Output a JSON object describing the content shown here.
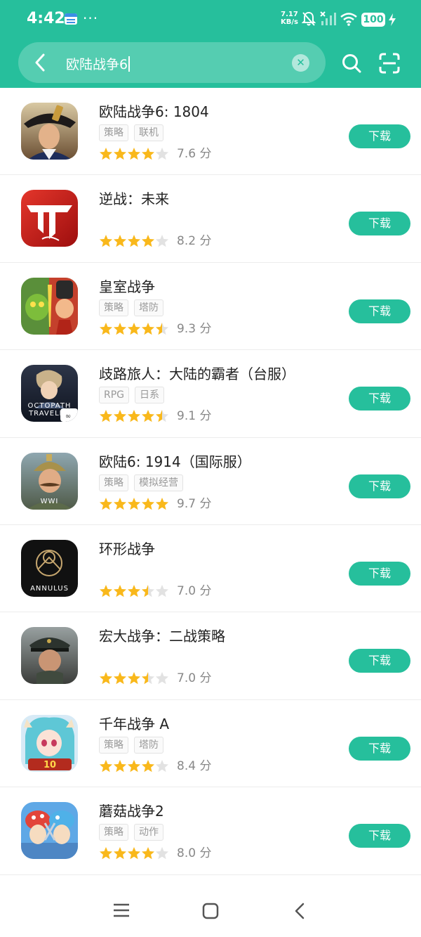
{
  "status_bar": {
    "time": "4:42",
    "more": "···",
    "speed_value": "7.17",
    "speed_unit": "KB/s",
    "battery": "100"
  },
  "search": {
    "query": "欧陆战争6"
  },
  "colors": {
    "accent": "#26bf9c",
    "star": "#f9b81b",
    "star_empty": "#e2e2e2"
  },
  "download_label": "下载",
  "apps": [
    {
      "name": "欧陆战争6: 1804",
      "tags": [
        "策略",
        "联机"
      ],
      "rating": 4,
      "score": "7.6 分",
      "icon": "napoleon-icon"
    },
    {
      "name": "逆战：未来",
      "tags": [],
      "rating": 4,
      "score": "8.2 分",
      "icon": "nizhan-logo-icon"
    },
    {
      "name": "皇室战争",
      "tags": [
        "策略",
        "塔防"
      ],
      "rating": 4.5,
      "score": "9.3 分",
      "icon": "clash-royale-icon"
    },
    {
      "name": "歧路旅人：大陆的霸者（台服）",
      "tags": [
        "RPG",
        "日系"
      ],
      "rating": 4.5,
      "score": "9.1 分",
      "icon": "octopath-icon",
      "icon_text": "OCTOPATH TRAVELER"
    },
    {
      "name": "欧陆6: 1914（国际服）",
      "tags": [
        "策略",
        "模拟经营"
      ],
      "rating": 5,
      "score": "9.7 分",
      "icon": "ww1-soldier-icon",
      "icon_text": "WWI"
    },
    {
      "name": "环形战争",
      "tags": [],
      "rating": 3.5,
      "score": "7.0 分",
      "icon": "annulus-icon",
      "icon_text": "ANNULUS"
    },
    {
      "name": "宏大战争：二战策略",
      "tags": [],
      "rating": 3.5,
      "score": "7.0 分",
      "icon": "ww2-officer-icon"
    },
    {
      "name": "千年战争 A",
      "tags": [
        "策略",
        "塔防"
      ],
      "rating": 4,
      "score": "8.4 分",
      "icon": "anime-girl-icon"
    },
    {
      "name": "蘑菇战争2",
      "tags": [
        "策略",
        "动作"
      ],
      "rating": 4,
      "score": "8.0 分",
      "icon": "mushroom-war-icon"
    }
  ]
}
